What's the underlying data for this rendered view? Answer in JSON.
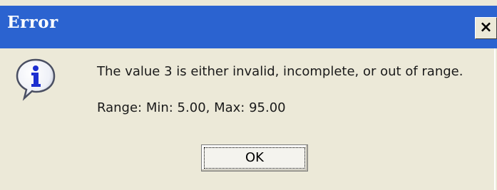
{
  "dialog": {
    "title": "Error",
    "close_label": "×",
    "icon": "info-icon",
    "message": "The value 3 is either invalid, incomplete, or out of range.",
    "range": "Range: Min: 5.00, Max: 95.00",
    "ok_label": "OK"
  },
  "colors": {
    "titlebar": "#2b63d0",
    "dialog_bg": "#ece9d8",
    "icon_fill": "#1d2fd0"
  }
}
